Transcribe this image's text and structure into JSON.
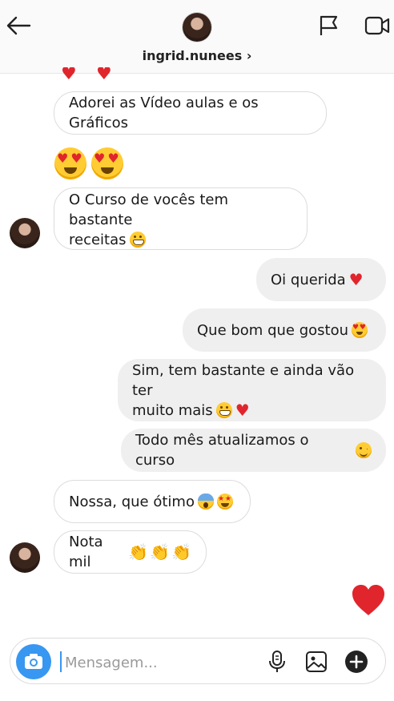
{
  "header": {
    "username": "ingrid.nunees",
    "chevron": "›",
    "icons": [
      "back-arrow-icon",
      "flag-icon",
      "video-call-icon"
    ]
  },
  "messages": [
    {
      "side": "in",
      "text": "Adorei as Vídeo aulas e os Gráficos",
      "emoji": []
    },
    {
      "side": "in",
      "text": "",
      "emoji": [
        "heart-eyes",
        "heart-eyes"
      ],
      "big": true
    },
    {
      "side": "in",
      "line1": "O Curso de vocês tem bastante",
      "line2": "receitas",
      "emoji": [
        "grin"
      ]
    },
    {
      "side": "out",
      "text": "Oi querida",
      "emoji": [
        "red-heart"
      ]
    },
    {
      "side": "out",
      "text": "Que bom que gostou",
      "emoji": [
        "heart-eyes"
      ]
    },
    {
      "side": "out",
      "line1": "Sim, tem bastante e ainda vão ter",
      "line2": "muito mais",
      "emoji": [
        "grin",
        "red-heart"
      ]
    },
    {
      "side": "out",
      "text": "Todo mês atualizamos o curso",
      "emoji": [
        "wink"
      ]
    },
    {
      "side": "in",
      "text": "Nossa, que ótimo",
      "emoji": [
        "scream",
        "star-struck"
      ]
    },
    {
      "side": "in",
      "text": "Nota mil",
      "emoji": [
        "clap",
        "clap",
        "clap"
      ]
    },
    {
      "side": "out",
      "text": "",
      "emoji": [
        "big-red-heart"
      ]
    }
  ],
  "composer": {
    "placeholder": "Mensagem...",
    "icons": [
      "camera-icon",
      "microphone-icon",
      "gallery-icon",
      "plus-icon"
    ]
  },
  "colors": {
    "accent": "#3897f0",
    "heart": "#e0252c",
    "outgoing_bubble": "#efefef",
    "incoming_border": "#dcdcdc"
  }
}
